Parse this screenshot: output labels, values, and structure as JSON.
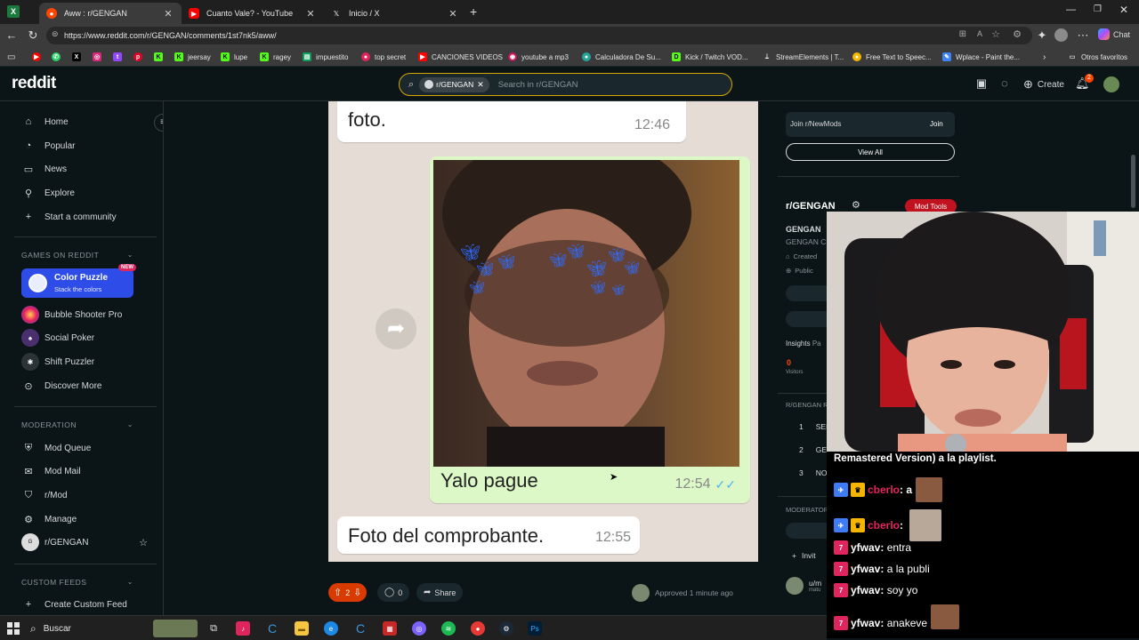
{
  "browser": {
    "tabs": [
      {
        "label": "Aww : r/GENGAN",
        "active": true,
        "icon": "reddit-favicon"
      },
      {
        "label": "Cuanto Vale? - YouTube",
        "active": false,
        "icon": "youtube-favicon"
      },
      {
        "label": "Inicio / X",
        "active": false,
        "icon": "x-favicon"
      }
    ],
    "url": "https://www.reddit.com/r/GENGAN/comments/1st7nk5/aww/",
    "bookmarks": [
      "jeersay",
      "lupe",
      "ragey",
      "impuestito",
      "top secret",
      "CANCIONES VIDEOS",
      "youtube a mp3",
      "Calculadora De Su...",
      "Kick / Twitch VOD...",
      "StreamElements | T...",
      "Free Text to Speec...",
      "Wplace - Paint the..."
    ],
    "other_favorites": "Otros favoritos",
    "copilot_label": "Chat"
  },
  "header": {
    "logo": "reddit",
    "search_chip": "r/GENGAN",
    "search_placeholder": "Search in r/GENGAN",
    "create_label": "Create",
    "notif_count": "2"
  },
  "sidebar": {
    "nav": [
      {
        "label": "Home",
        "icon": "home-icon"
      },
      {
        "label": "Popular",
        "icon": "popular-icon"
      },
      {
        "label": "News",
        "icon": "news-icon"
      },
      {
        "label": "Explore",
        "icon": "explore-icon"
      },
      {
        "label": "Start a community",
        "icon": "plus-icon"
      }
    ],
    "games_title": "GAMES ON REDDIT",
    "featured_game": {
      "title": "Color Puzzle",
      "subtitle": "Stack the colors",
      "badge": "NEW"
    },
    "games": [
      "Bubble Shooter Pro",
      "Social Poker",
      "Shift Puzzler",
      "Discover More"
    ],
    "moderation_title": "MODERATION",
    "moderation": [
      "Mod Queue",
      "Mod Mail",
      "r/Mod",
      "Manage",
      "r/GENGAN"
    ],
    "custom_feeds_title": "CUSTOM FEEDS",
    "create_feed": "Create Custom Feed"
  },
  "post": {
    "top_text": "foto.",
    "top_time": "12:46",
    "caption": "Yalo pague",
    "caption_time": "12:54",
    "bottom_text": "Foto del comprobante.",
    "bottom_time": "12:55",
    "votes": "2",
    "comments": "0",
    "share_label": "Share",
    "approved": "Approved 1 minute ago"
  },
  "right_sidebar": {
    "join_text": "Join r/NewMods",
    "join_btn": "Join",
    "view_all": "View All",
    "community": "r/GENGAN",
    "mod_tools": "Mod Tools",
    "community_short": "GENGAN",
    "community_sub": "GENGAN C",
    "created": "Created",
    "public": "Public",
    "insights": "Insights",
    "insights_sub": "Pa",
    "visitors_num": "0",
    "visitors_label": "Visitors",
    "rules_title": "R/GENGAN R",
    "rules": [
      {
        "n": "1",
        "t": "SER"
      },
      {
        "n": "2",
        "t": "GEN"
      },
      {
        "n": "3",
        "t": "NO"
      }
    ],
    "moderators_title": "MODERATOR",
    "invite": "Invit",
    "mod_user": "u/m",
    "mod_user_sub": "matu"
  },
  "stream_chat": {
    "banner": "Remastered Version) a la playlist.",
    "messages": [
      {
        "user": "cberlo",
        "text": "a",
        "user_color": "#e0245e"
      },
      {
        "user": "cberlo",
        "text": "",
        "user_color": "#e0245e"
      },
      {
        "user": "yfwav",
        "text": "entra",
        "user_color": "#ffffff"
      },
      {
        "user": "yfwav",
        "text": "a la publi",
        "user_color": "#ffffff"
      },
      {
        "user": "yfwav",
        "text": "soy yo",
        "user_color": "#ffffff"
      },
      {
        "user": "yfwav",
        "text": "anakeve",
        "user_color": "#ffffff"
      }
    ]
  },
  "taskbar": {
    "search_label": "Buscar"
  },
  "colors": {
    "reddit_bg": "#0b1416",
    "accent_orange": "#ff4500",
    "mod_red": "#c1121f",
    "search_border": "#d8a800"
  }
}
